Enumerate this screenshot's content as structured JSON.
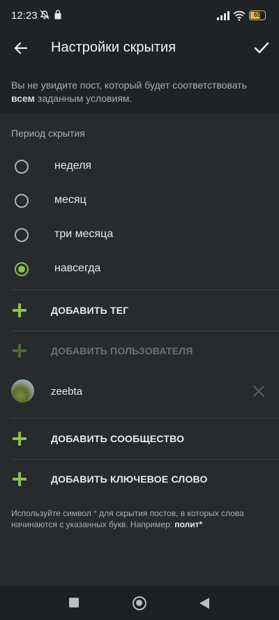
{
  "status_bar": {
    "time": "12:23",
    "icons": [
      "mute-icon",
      "lock-icon",
      "signal-icon",
      "wifi-icon"
    ],
    "battery_level": "65",
    "battery_color": "#e6b84a"
  },
  "header": {
    "title": "Настройки скрытия",
    "back_icon": "arrow-left-icon",
    "confirm_icon": "checkmark-icon"
  },
  "info": {
    "text_before": "Вы не увидите пост, который будет соответствовать ",
    "text_bold": "всем",
    "text_after": " заданным условиям."
  },
  "period": {
    "label": "Период скрытия",
    "options": [
      {
        "label": "неделя",
        "selected": false
      },
      {
        "label": "месяц",
        "selected": false
      },
      {
        "label": "три месяца",
        "selected": false
      },
      {
        "label": "навсегда",
        "selected": true
      }
    ]
  },
  "actions": {
    "add_tag": "ДОБАВИТЬ ТЕГ",
    "add_user": "ДОБАВИТЬ ПОЛЬЗОВАТЕЛЯ",
    "add_community": "ДОБАВИТЬ СООБЩЕСТВО",
    "add_keyword": "ДОБАВИТЬ КЛЮЧЕВОЕ СЛОВО"
  },
  "user": {
    "name": "zeebta"
  },
  "hint": {
    "text_before": "Используйте символ ",
    "star": "*",
    "text_middle": " для скрытия постов, в которых слова начинаются с указанных букв. Например: ",
    "example": "полит*"
  },
  "colors": {
    "accent": "#8cc152",
    "background": "#272b2e",
    "header": "#202325",
    "star": "#d9654a"
  }
}
